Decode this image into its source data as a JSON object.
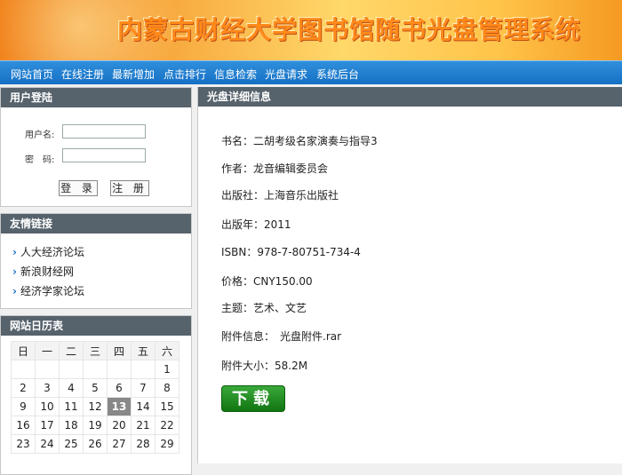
{
  "banner": {
    "title": "内蒙古财经大学图书馆随书光盘管理系统"
  },
  "nav": {
    "items": [
      "网站首页",
      "在线注册",
      "最新增加",
      "点击排行",
      "信息检索",
      "光盘请求",
      "系统后台"
    ]
  },
  "login": {
    "heading": "用户登陆",
    "username_label": "用户名:",
    "password_label": "密　码:",
    "login_button": "登 录",
    "register_button": "注 册"
  },
  "links": {
    "heading": "友情链接",
    "items": [
      "人大经济论坛",
      "新浪财经网",
      "经济学家论坛"
    ]
  },
  "calendar": {
    "heading": "网站日历表",
    "weekdays": [
      "日",
      "一",
      "二",
      "三",
      "四",
      "五",
      "六"
    ],
    "weeks": [
      [
        "",
        "",
        "",
        "",
        "",
        "",
        "1"
      ],
      [
        "2",
        "3",
        "4",
        "5",
        "6",
        "7",
        "8"
      ],
      [
        "9",
        "10",
        "11",
        "12",
        "13",
        "14",
        "15"
      ],
      [
        "16",
        "17",
        "18",
        "19",
        "20",
        "21",
        "22"
      ],
      [
        "23",
        "24",
        "25",
        "26",
        "27",
        "28",
        "29"
      ]
    ],
    "today": "13"
  },
  "detail": {
    "heading": "光盘详细信息",
    "book_name": "书名：二胡考级名家演奏与指导3",
    "author": "作者：龙音编辑委员会",
    "publisher": "出版社：上海音乐出版社",
    "year": "出版年：2011",
    "isbn": "ISBN：978-7-80751-734-4",
    "price": "价格：CNY150.00",
    "subject": "主题：艺术、文艺",
    "attachment": "附件信息：　光盘附件.rar",
    "size": "附件大小：58.2M",
    "download_label": "下载"
  }
}
